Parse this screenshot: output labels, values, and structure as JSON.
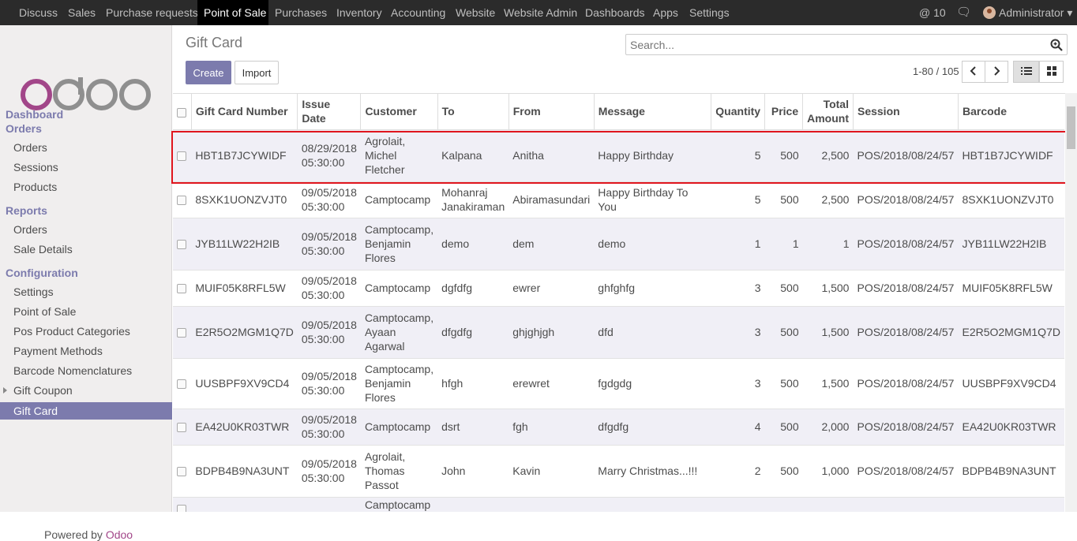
{
  "topbar": {
    "menus": [
      "Discuss",
      "Sales",
      "Purchase requests",
      "Point of Sale",
      "Purchases",
      "Inventory",
      "Accounting",
      "Website",
      "Website Admin",
      "Dashboards",
      "Apps",
      "Settings"
    ],
    "active_menu": "Point of Sale",
    "mentions": "@ 10",
    "user": "Administrator ▾"
  },
  "sidebar": {
    "logo": "odoo",
    "sections": [
      {
        "label": "Dashboard"
      },
      {
        "label": "Orders",
        "items": [
          "Orders",
          "Sessions",
          "Products"
        ]
      },
      {
        "label": "Reports",
        "items": [
          "Orders",
          "Sale Details"
        ]
      },
      {
        "label": "Configuration",
        "items": [
          "Settings",
          "Point of Sale",
          "Pos Product Categories",
          "Payment Methods",
          "Barcode Nomenclatures",
          "Gift Coupon",
          "Gift Card"
        ]
      }
    ],
    "active_item": "Gift Card",
    "powered_prefix": "Powered by ",
    "powered_brand": "Odoo"
  },
  "main": {
    "title": "Gift Card",
    "create_label": "Create",
    "import_label": "Import",
    "search_placeholder": "Search...",
    "pager": "1-80 / 105",
    "columns": [
      "Gift Card Number",
      "Issue Date",
      "Customer",
      "To",
      "From",
      "Message",
      "Quantity",
      "Price",
      "Total Amount",
      "Session",
      "Barcode"
    ],
    "rows": [
      [
        "HBT1B7JCYWIDF",
        "08/29/2018 05:30:00",
        "Agrolait, Michel Fletcher",
        "Kalpana",
        "Anitha",
        "Happy Birthday",
        "5",
        "500",
        "2,500",
        "POS/2018/08/24/57",
        "HBT1B7JCYWIDF"
      ],
      [
        "8SXK1UONZVJT0",
        "09/05/2018 05:30:00",
        "Camptocamp",
        "Mohanraj Janakiraman",
        "Abiramasundari",
        "Happy Birthday To You",
        "5",
        "500",
        "2,500",
        "POS/2018/08/24/57",
        "8SXK1UONZVJT0"
      ],
      [
        "JYB11LW22H2IB",
        "09/05/2018 05:30:00",
        "Camptocamp, Benjamin Flores",
        "demo",
        "dem",
        "demo",
        "1",
        "1",
        "1",
        "POS/2018/08/24/57",
        "JYB11LW22H2IB"
      ],
      [
        "MUIF05K8RFL5W",
        "09/05/2018 05:30:00",
        "Camptocamp",
        "dgfdfg",
        "ewrer",
        "ghfghfg",
        "3",
        "500",
        "1,500",
        "POS/2018/08/24/57",
        "MUIF05K8RFL5W"
      ],
      [
        "E2R5O2MGM1Q7D",
        "09/05/2018 05:30:00",
        "Camptocamp, Ayaan Agarwal",
        "dfgdfg",
        "ghjghjgh",
        "dfd",
        "3",
        "500",
        "1,500",
        "POS/2018/08/24/57",
        "E2R5O2MGM1Q7D"
      ],
      [
        "UUSBPF9XV9CD4",
        "09/05/2018 05:30:00",
        "Camptocamp, Benjamin Flores",
        "hfgh",
        "erewret",
        "fgdgdg",
        "3",
        "500",
        "1,500",
        "POS/2018/08/24/57",
        "UUSBPF9XV9CD4"
      ],
      [
        "EA42U0KR03TWR",
        "09/05/2018 05:30:00",
        "Camptocamp",
        "dsrt",
        "fgh",
        "dfgdfg",
        "4",
        "500",
        "2,000",
        "POS/2018/08/24/57",
        "EA42U0KR03TWR"
      ],
      [
        "BDPB4B9NA3UNT",
        "09/05/2018 05:30:00",
        "Agrolait, Thomas Passot",
        "John",
        "Kavin",
        "Marry Christmas...!!!",
        "2",
        "500",
        "1,000",
        "POS/2018/08/24/57",
        "BDPB4B9NA3UNT"
      ],
      [
        "",
        "",
        "Camptocamp",
        "",
        "",
        "",
        "",
        "",
        "",
        "",
        ""
      ]
    ]
  },
  "colors": {
    "accent": "#7c7bad",
    "highlight": "#e0151e",
    "topbar": "#2b2b2b"
  }
}
